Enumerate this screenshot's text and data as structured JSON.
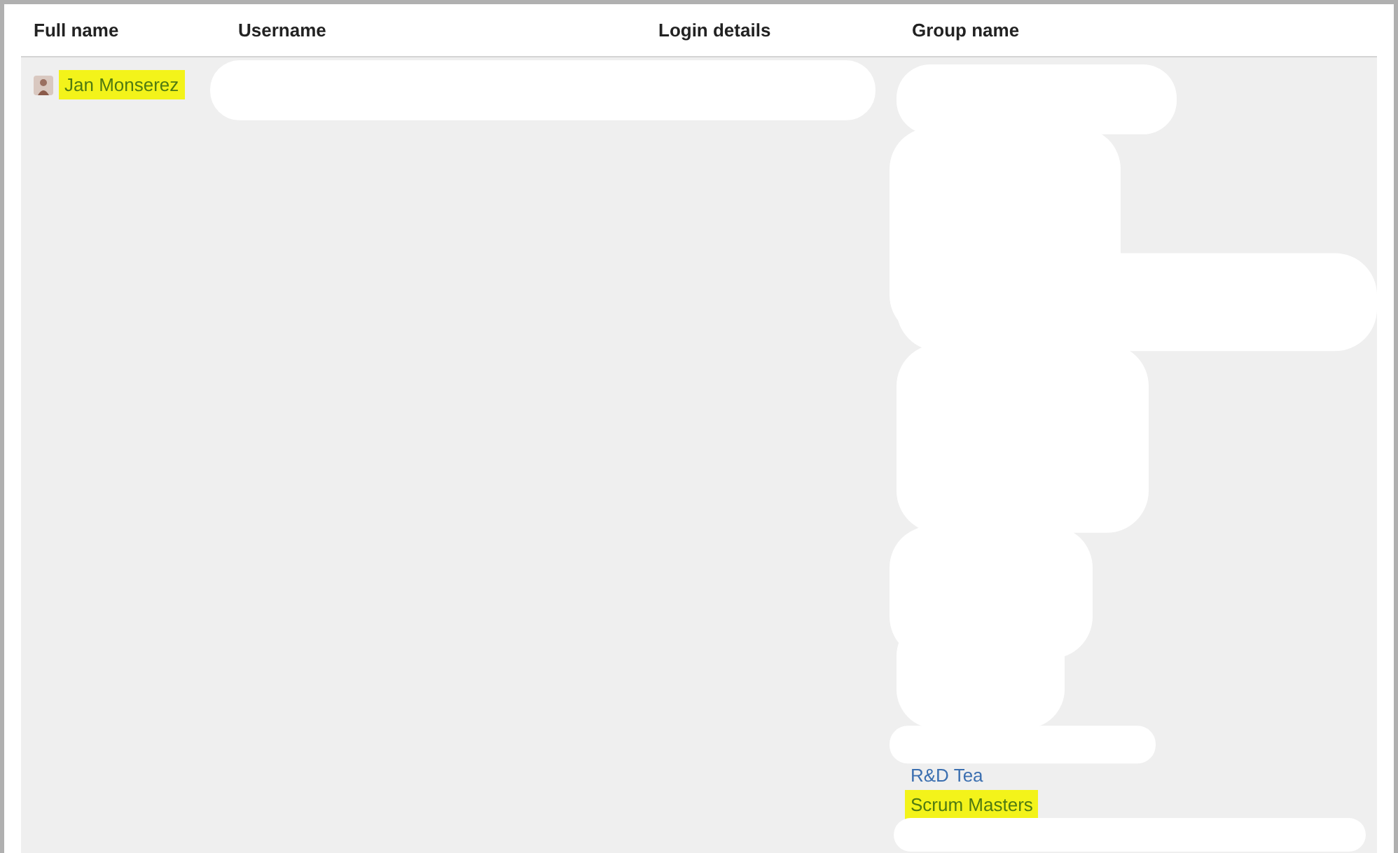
{
  "columns": [
    "Full name",
    "Username",
    "Login details",
    "Group name"
  ],
  "rows": [
    {
      "full_name": {
        "text": "Jan Monserez",
        "highlighted": true
      },
      "groups": [
        {
          "text": "R&D Tea",
          "highlighted": false
        },
        {
          "text": "Scrum Masters",
          "highlighted": true
        }
      ]
    }
  ]
}
